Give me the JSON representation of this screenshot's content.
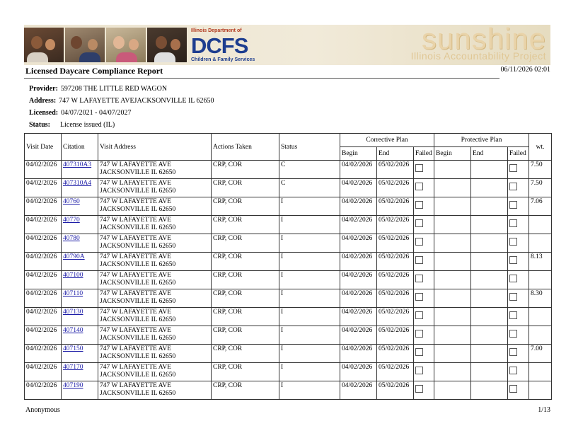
{
  "banner": {
    "agency_line1": "Illinois Department of",
    "agency_logo": "DCFS",
    "agency_line2": "Children & Family Services",
    "brand_word": "sunshine",
    "brand_tagline": "Illinois Accountability Project",
    "colors": {
      "dcfs_blue": "#1d3d8f",
      "dcfs_red": "#b23a1f",
      "sunshine_text": "#e9d3a9"
    }
  },
  "report": {
    "title": "Licensed Daycare Compliance Report",
    "date": "06/11/2026 02:01"
  },
  "provider": {
    "provider_label": "Provider:",
    "provider_value": "597208 THE LITTLE RED WAGON",
    "address_label": "Address:",
    "address_value": "747 W LAFAYETTE AVEJACKSONVILLE IL 62650",
    "licensed_label": "Licensed:",
    "licensed_value": "04/07/2021 - 04/07/2027",
    "status_label": "Status:",
    "status_value": "License issued (IL)"
  },
  "table": {
    "headers": {
      "visit_date": "Visit Date",
      "citation": "Citation",
      "visit_address": "Visit Address",
      "actions_taken": "Actions Taken",
      "status": "Status",
      "corrective_plan": "Corrective Plan",
      "protective_plan": "Protective Plan",
      "begin": "Begin",
      "end": "End",
      "failed": "Failed",
      "wt": "wt."
    },
    "rows": [
      {
        "visit_date": "04/02/2026",
        "citation": "407310A3",
        "address1": "747 W LAFAYETTE AVE",
        "address2": "JACKSONVILLE IL 62650",
        "actions": "CRP, COR",
        "status": "C",
        "cp_begin": "04/02/2026",
        "cp_end": "05/02/2026",
        "pp_begin": "",
        "pp_end": "",
        "wt": "7.50"
      },
      {
        "visit_date": "04/02/2026",
        "citation": "407310A4",
        "address1": "747 W LAFAYETTE AVE",
        "address2": "JACKSONVILLE IL 62650",
        "actions": "CRP, COR",
        "status": "C",
        "cp_begin": "04/02/2026",
        "cp_end": "05/02/2026",
        "pp_begin": "",
        "pp_end": "",
        "wt": "7.50"
      },
      {
        "visit_date": "04/02/2026",
        "citation": "40760",
        "address1": "747 W LAFAYETTE AVE",
        "address2": "JACKSONVILLE IL 62650",
        "actions": "CRP, COR",
        "status": "I",
        "cp_begin": "04/02/2026",
        "cp_end": "05/02/2026",
        "pp_begin": "",
        "pp_end": "",
        "wt": "7.06"
      },
      {
        "visit_date": "04/02/2026",
        "citation": "40770",
        "address1": "747 W LAFAYETTE AVE",
        "address2": "JACKSONVILLE IL 62650",
        "actions": "CRP, COR",
        "status": "I",
        "cp_begin": "04/02/2026",
        "cp_end": "05/02/2026",
        "pp_begin": "",
        "pp_end": "",
        "wt": ""
      },
      {
        "visit_date": "04/02/2026",
        "citation": "40780",
        "address1": "747 W LAFAYETTE AVE",
        "address2": "JACKSONVILLE IL 62650",
        "actions": "CRP, COR",
        "status": "I",
        "cp_begin": "04/02/2026",
        "cp_end": "05/02/2026",
        "pp_begin": "",
        "pp_end": "",
        "wt": ""
      },
      {
        "visit_date": "04/02/2026",
        "citation": "40790A",
        "address1": "747 W LAFAYETTE AVE",
        "address2": "JACKSONVILLE IL 62650",
        "actions": "CRP, COR",
        "status": "I",
        "cp_begin": "04/02/2026",
        "cp_end": "05/02/2026",
        "pp_begin": "",
        "pp_end": "",
        "wt": "8.13"
      },
      {
        "visit_date": "04/02/2026",
        "citation": "407100",
        "address1": "747 W LAFAYETTE AVE",
        "address2": "JACKSONVILLE IL 62650",
        "actions": "CRP, COR",
        "status": "I",
        "cp_begin": "04/02/2026",
        "cp_end": "05/02/2026",
        "pp_begin": "",
        "pp_end": "",
        "wt": ""
      },
      {
        "visit_date": "04/02/2026",
        "citation": "407110",
        "address1": "747 W LAFAYETTE AVE",
        "address2": "JACKSONVILLE IL 62650",
        "actions": "CRP, COR",
        "status": "I",
        "cp_begin": "04/02/2026",
        "cp_end": "05/02/2026",
        "pp_begin": "",
        "pp_end": "",
        "wt": "8.30"
      },
      {
        "visit_date": "04/02/2026",
        "citation": "407130",
        "address1": "747 W LAFAYETTE AVE",
        "address2": "JACKSONVILLE IL 62650",
        "actions": "CRP, COR",
        "status": "I",
        "cp_begin": "04/02/2026",
        "cp_end": "05/02/2026",
        "pp_begin": "",
        "pp_end": "",
        "wt": ""
      },
      {
        "visit_date": "04/02/2026",
        "citation": "407140",
        "address1": "747 W LAFAYETTE AVE",
        "address2": "JACKSONVILLE IL 62650",
        "actions": "CRP, COR",
        "status": "I",
        "cp_begin": "04/02/2026",
        "cp_end": "05/02/2026",
        "pp_begin": "",
        "pp_end": "",
        "wt": ""
      },
      {
        "visit_date": "04/02/2026",
        "citation": "407150",
        "address1": "747 W LAFAYETTE AVE",
        "address2": "JACKSONVILLE IL 62650",
        "actions": "CRP, COR",
        "status": "I",
        "cp_begin": "04/02/2026",
        "cp_end": "05/02/2026",
        "pp_begin": "",
        "pp_end": "",
        "wt": "7.00"
      },
      {
        "visit_date": "04/02/2026",
        "citation": "407170",
        "address1": "747 W LAFAYETTE AVE",
        "address2": "JACKSONVILLE IL 62650",
        "actions": "CRP, COR",
        "status": "I",
        "cp_begin": "04/02/2026",
        "cp_end": "05/02/2026",
        "pp_begin": "",
        "pp_end": "",
        "wt": ""
      },
      {
        "visit_date": "04/02/2026",
        "citation": "407190",
        "address1": "747 W LAFAYETTE AVE",
        "address2": "JACKSONVILLE IL 62650",
        "actions": "CRP, COR",
        "status": "I",
        "cp_begin": "04/02/2026",
        "cp_end": "05/02/2026",
        "pp_begin": "",
        "pp_end": "",
        "wt": ""
      }
    ]
  },
  "footer": {
    "user": "Anonymous",
    "page": "1/13"
  }
}
